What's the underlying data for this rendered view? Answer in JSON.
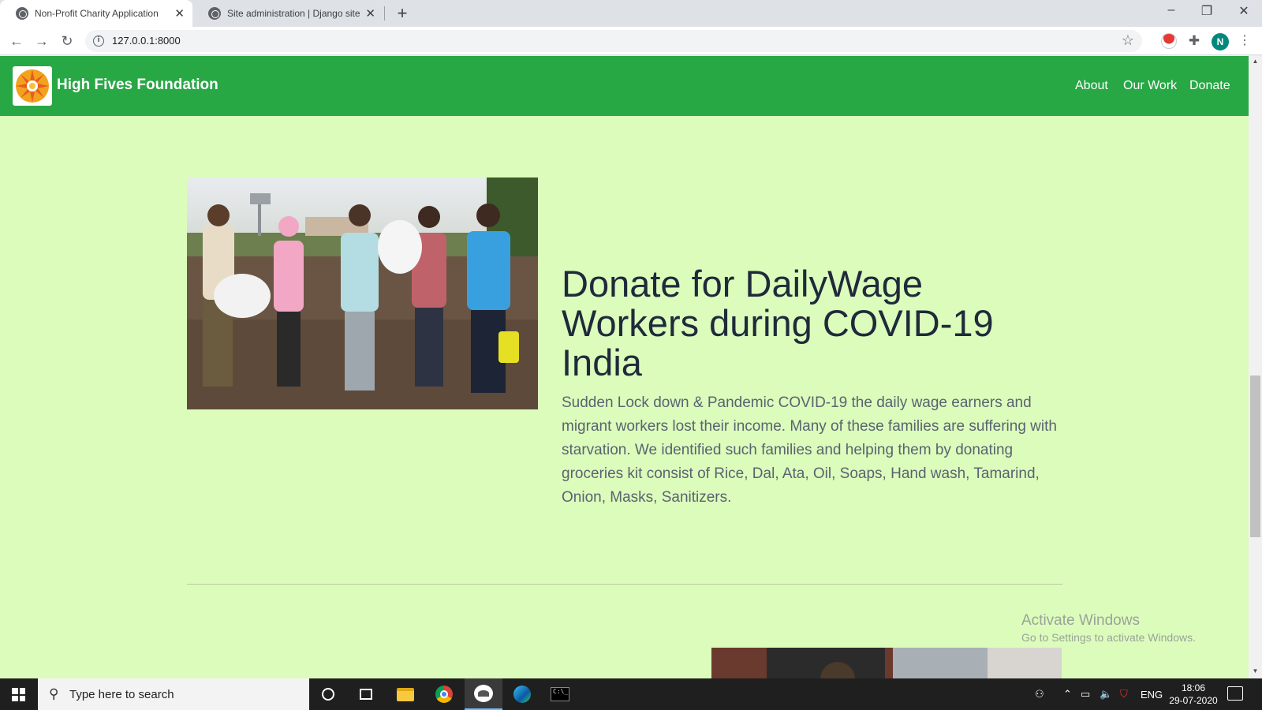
{
  "browser": {
    "tabs": [
      {
        "title": "Non-Profit Charity Application",
        "active": true
      },
      {
        "title": "Site administration | Django site",
        "active": false
      }
    ],
    "url": "127.0.0.1:8000",
    "profile_initial": "N"
  },
  "site": {
    "brand": "High Fives Foundation",
    "nav": [
      "About",
      "Our Work",
      "Donate"
    ],
    "hero": {
      "title": "Donate for DailyWage Workers during COVID-19 India",
      "text": "Sudden Lock down & Pandemic COVID-19 the daily wage earners and migrant workers lost their income. Many of these families are suffering with starvation. We identified such families and helping them by donating groceries kit consist of Rice, Dal, Ata, Oil, Soaps, Hand wash, Tamarind, Onion, Masks, Sanitizers."
    },
    "colors": {
      "navbar": "#28a745",
      "page_bg": "#dcfcbc"
    }
  },
  "watermark": {
    "line1": "Activate Windows",
    "line2": "Go to Settings to activate Windows."
  },
  "taskbar": {
    "search_placeholder": "Type here to search",
    "language": "ENG",
    "time": "18:06",
    "date": "29-07-2020"
  }
}
